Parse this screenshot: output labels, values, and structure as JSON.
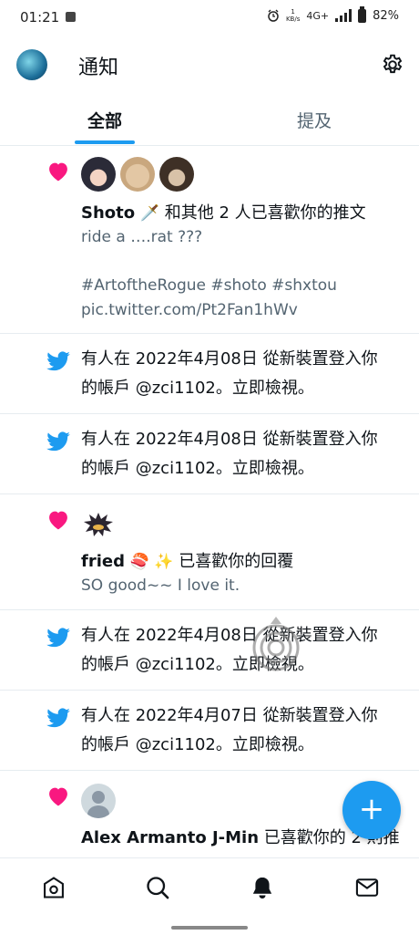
{
  "status_bar": {
    "time": "01:21",
    "speed_value": "1",
    "speed_unit": "KB/s",
    "network": "4G+",
    "battery": "82%"
  },
  "header": {
    "title": "通知"
  },
  "tabs": [
    {
      "label": "全部",
      "active": true
    },
    {
      "label": "提及",
      "active": false
    }
  ],
  "notifications": [
    {
      "type": "like",
      "name": "Shoto",
      "name_emoji": "🗡️",
      "action": " 和其他 2 人已喜歡你的推文",
      "body_line1": "ride a ….rat ???",
      "body_line2": "#ArtoftheRogue #shoto #shxtou",
      "body_line3": "pic.twitter.com/Pt2Fan1hWv"
    },
    {
      "type": "login",
      "line1": "有人在 2022年4月08日 從新裝置登入你",
      "line2": "的帳戶 @zci1102。立即檢視。"
    },
    {
      "type": "login",
      "line1": "有人在 2022年4月08日 從新裝置登入你",
      "line2": "的帳戶 @zci1102。立即檢視。"
    },
    {
      "type": "like",
      "name": "fried",
      "name_emoji": "🍣 ✨",
      "action": " 已喜歡你的回覆",
      "body_line1": "SO good~~ I love it."
    },
    {
      "type": "login",
      "line1": "有人在 2022年4月08日 從新裝置登入你",
      "line2": "的帳戶 @zci1102。立即檢視。"
    },
    {
      "type": "login",
      "line1": "有人在 2022年4月07日 從新裝置登入你",
      "line2": "的帳戶 @zci1102。立即檢視。"
    },
    {
      "type": "like",
      "name": "Alex Armanto J-Min",
      "action": " 已喜歡你的 2 則推"
    }
  ],
  "fab": {
    "label": "+"
  },
  "colors": {
    "accent": "#1d9bf0",
    "heart": "#f91880",
    "text": "#0f1419",
    "secondary": "#536471",
    "divider": "#e6ecf0"
  },
  "bottom_nav": [
    "home-icon",
    "search-icon",
    "bell-icon",
    "mail-icon"
  ]
}
